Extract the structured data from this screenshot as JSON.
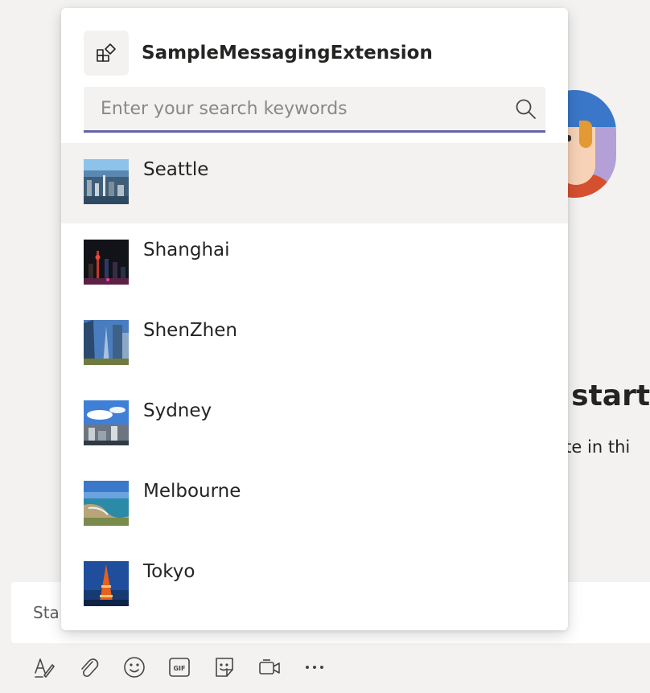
{
  "background": {
    "heading": "n start",
    "subtext": "pate in thi",
    "compose_placeholder": "Sta"
  },
  "extension": {
    "name": "SampleMessagingExtension",
    "icon": "apps-icon"
  },
  "search": {
    "placeholder": "Enter your search keywords",
    "value": "",
    "icon": "search-icon"
  },
  "results": [
    {
      "label": "Seattle",
      "thumbnail": "city-skyline-photo",
      "selected": true
    },
    {
      "label": "Shanghai",
      "thumbnail": "night-city-photo",
      "selected": false
    },
    {
      "label": "ShenZhen",
      "thumbnail": "towers-photo",
      "selected": false
    },
    {
      "label": "Sydney",
      "thumbnail": "harbour-city-photo",
      "selected": false
    },
    {
      "label": "Melbourne",
      "thumbnail": "coastline-photo",
      "selected": false
    },
    {
      "label": "Tokyo",
      "thumbnail": "tokyo-tower-photo",
      "selected": false
    }
  ],
  "toolbar": [
    {
      "name": "format-icon"
    },
    {
      "name": "attach-icon"
    },
    {
      "name": "emoji-icon"
    },
    {
      "name": "gif-icon"
    },
    {
      "name": "sticker-icon"
    },
    {
      "name": "meet-now-icon"
    },
    {
      "name": "more-options-icon"
    }
  ],
  "colors": {
    "accent": "#6264a7",
    "selected_row": "#f3f2f1",
    "app_background": "#f3f2f1"
  }
}
